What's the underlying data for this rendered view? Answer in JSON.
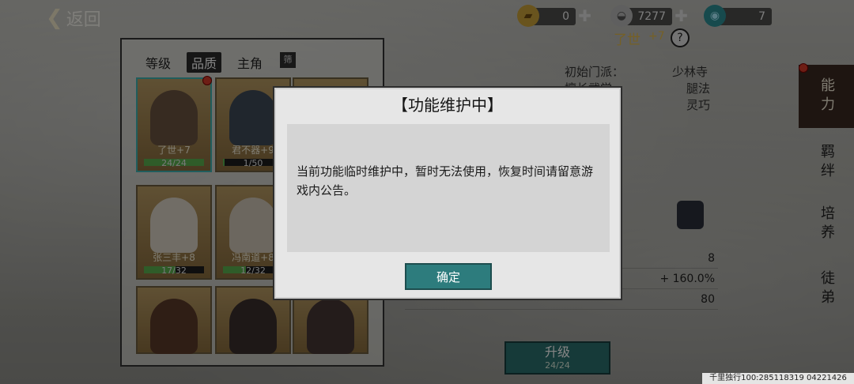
{
  "topbar": {
    "back_label": "返回",
    "gold": "0",
    "silver": "7277",
    "gem": "7"
  },
  "hero": {
    "name": "了世",
    "plus": "+7"
  },
  "tabs": [
    "等级",
    "品质",
    "主角",
    "筛"
  ],
  "cards": [
    {
      "name": "了世+7",
      "bar": "24/24",
      "fill": 1.0
    },
    {
      "name": "君不器+9",
      "bar": "1/50",
      "fill": 0.02
    },
    {
      "name": "张三丰+8",
      "bar": "17/32",
      "fill": 0.53
    },
    {
      "name": "冯南道+8",
      "bar": "12/32",
      "fill": 0.38
    }
  ],
  "stats": {
    "sect_label": "初始门派：",
    "sect_value": "少林寺",
    "skill_label": "擅长武学",
    "skill_value": "腿法",
    "extra_value": "灵巧"
  },
  "stat_rows": [
    "8",
    "+ 160.0%",
    "80"
  ],
  "side_tabs": [
    "能力",
    "羁绊",
    "培养",
    "徒弟"
  ],
  "upgrade": {
    "label": "升级",
    "bar": "24/24"
  },
  "dialog": {
    "title": "【功能维护中】",
    "message": "当前功能临时维护中，暂时无法使用，恢复时间请留意游戏内公告。",
    "ok_label": "确定"
  },
  "watermark": "千里独行100:285118319 04221426"
}
